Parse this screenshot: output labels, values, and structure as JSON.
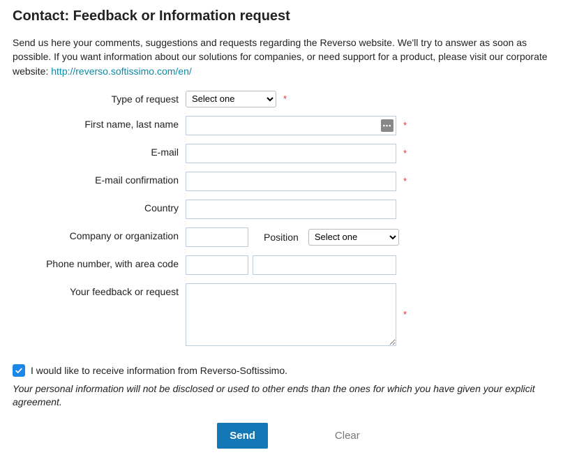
{
  "heading": "Contact: Feedback or Information request",
  "intro_text": "Send us here your comments, suggestions and requests regarding the Reverso website. We'll try to answer as soon as possible. If you want information about our solutions for companies, or need support for a product, please visit our corporate website: ",
  "intro_link": "http://reverso.softissimo.com/en/",
  "labels": {
    "type": "Type of request",
    "name": "First name, last name",
    "email": "E-mail",
    "email_confirm": "E-mail confirmation",
    "country": "Country",
    "company": "Company or organization",
    "position": "Position",
    "phone": "Phone number, with area code",
    "feedback": "Your feedback or request"
  },
  "select_placeholder": "Select one",
  "values": {
    "type": "",
    "name": "",
    "email": "",
    "email_confirm": "",
    "country": "",
    "company": "",
    "position": "",
    "phone_code": "",
    "phone_number": "",
    "feedback": ""
  },
  "consent_label": "I would like to receive information from Reverso-Softissimo.",
  "consent_checked": true,
  "disclaimer": "Your personal information will not be disclosed or used to other ends than the ones for which you have given your explicit agreement.",
  "buttons": {
    "send": "Send",
    "clear": "Clear"
  },
  "asterisk": "*"
}
